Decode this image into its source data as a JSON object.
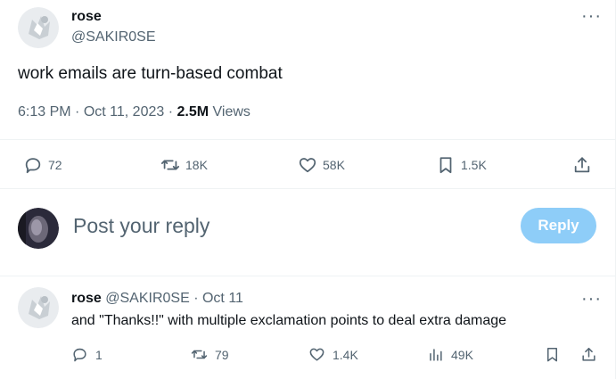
{
  "tweet": {
    "display_name": "rose",
    "handle": "@SAKIR0SE",
    "text": "work emails are turn-based combat",
    "time": "6:13 PM",
    "sep1": "·",
    "date": "Oct 11, 2023",
    "sep2": "·",
    "views_count": "2.5M",
    "views_label": "Views",
    "replies": "72",
    "reposts": "18K",
    "likes": "58K",
    "bookmarks": "1.5K"
  },
  "composer": {
    "placeholder": "Post your reply",
    "button_label": "Reply"
  },
  "reply": {
    "display_name": "rose",
    "handle": "@SAKIR0SE",
    "sep": "·",
    "date": "Oct 11",
    "text": "and \"Thanks!!\" with multiple exclamation points to deal extra damage",
    "replies": "1",
    "reposts": "79",
    "likes": "1.4K",
    "views": "49K"
  },
  "icons": {
    "more": "more-horizontal-icon",
    "reply": "speech-bubble-icon",
    "repost": "repost-arrows-icon",
    "like": "heart-icon",
    "bookmark": "bookmark-icon",
    "share": "share-upload-icon",
    "views": "bar-chart-icon"
  },
  "colors": {
    "text": "#0f1419",
    "muted": "#536471",
    "reply_button": "#8ecdf8",
    "divider": "#eff3f4"
  }
}
